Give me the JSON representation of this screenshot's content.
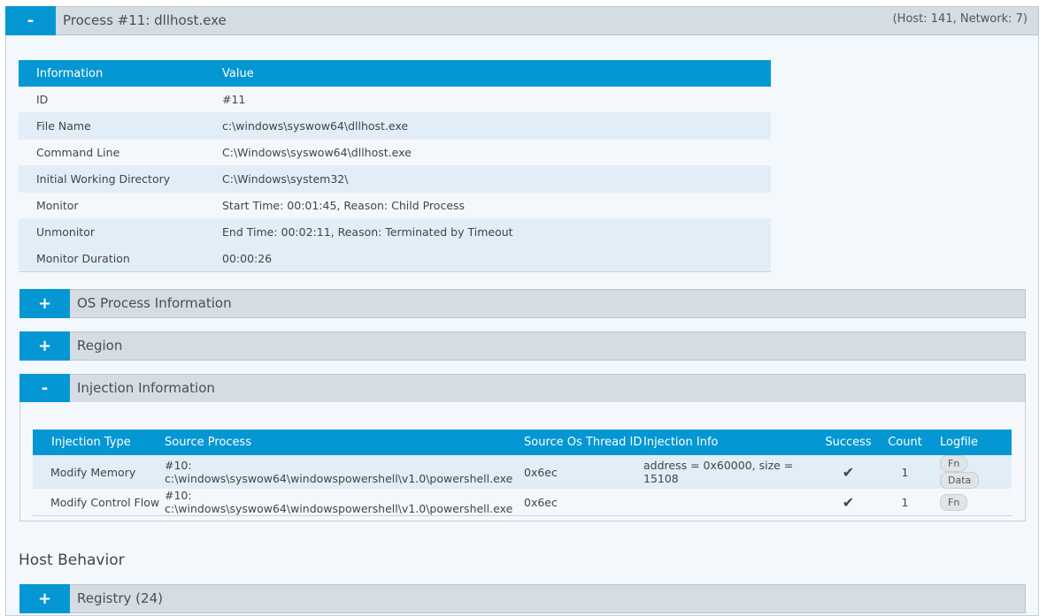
{
  "process_panel": {
    "toggle": "-",
    "title": "Process #11: dllhost.exe",
    "counts": "(Host: 141, Network: 7)"
  },
  "info_table": {
    "headers": [
      "Information",
      "Value"
    ],
    "rows": [
      {
        "label": "ID",
        "value": "#11"
      },
      {
        "label": "File Name",
        "value": "c:\\windows\\syswow64\\dllhost.exe"
      },
      {
        "label": "Command Line",
        "value": "C:\\Windows\\syswow64\\dllhost.exe"
      },
      {
        "label": "Initial Working Directory",
        "value": "C:\\Windows\\system32\\"
      },
      {
        "label": "Monitor",
        "value": "Start Time: 00:01:45, Reason: Child Process"
      },
      {
        "label": "Unmonitor",
        "value": "End Time: 00:02:11, Reason: Terminated by Timeout"
      },
      {
        "label": "Monitor Duration",
        "value": "00:00:26"
      }
    ]
  },
  "sections": {
    "os_process": {
      "toggle": "+",
      "title": "OS Process Information"
    },
    "region": {
      "toggle": "+",
      "title": "Region"
    },
    "injection": {
      "toggle": "-",
      "title": "Injection Information"
    },
    "registry": {
      "toggle": "+",
      "title": "Registry (24)"
    }
  },
  "injection_table": {
    "headers": [
      "Injection Type",
      "Source Process",
      "Source Os Thread ID",
      "Injection Info",
      "Success",
      "Count",
      "Logfile"
    ],
    "rows": [
      {
        "type": "Modify Memory",
        "source": "#10: c:\\windows\\syswow64\\windowspowershell\\v1.0\\powershell.exe",
        "thread": "0x6ec",
        "info": "address = 0x60000, size = 15108",
        "success": "✔",
        "count": "1",
        "logfile_fn": "Fn",
        "logfile_data": "Data"
      },
      {
        "type": "Modify Control Flow",
        "source": "#10: c:\\windows\\syswow64\\windowspowershell\\v1.0\\powershell.exe",
        "thread": "0x6ec",
        "info": "",
        "success": "✔",
        "count": "1",
        "logfile_fn": "Fn"
      }
    ]
  },
  "host_behavior_heading": "Host Behavior",
  "colors": {
    "accent": "#0597d3",
    "bar_bg": "#d3dde3",
    "panel_bg": "#f3f8fd"
  }
}
